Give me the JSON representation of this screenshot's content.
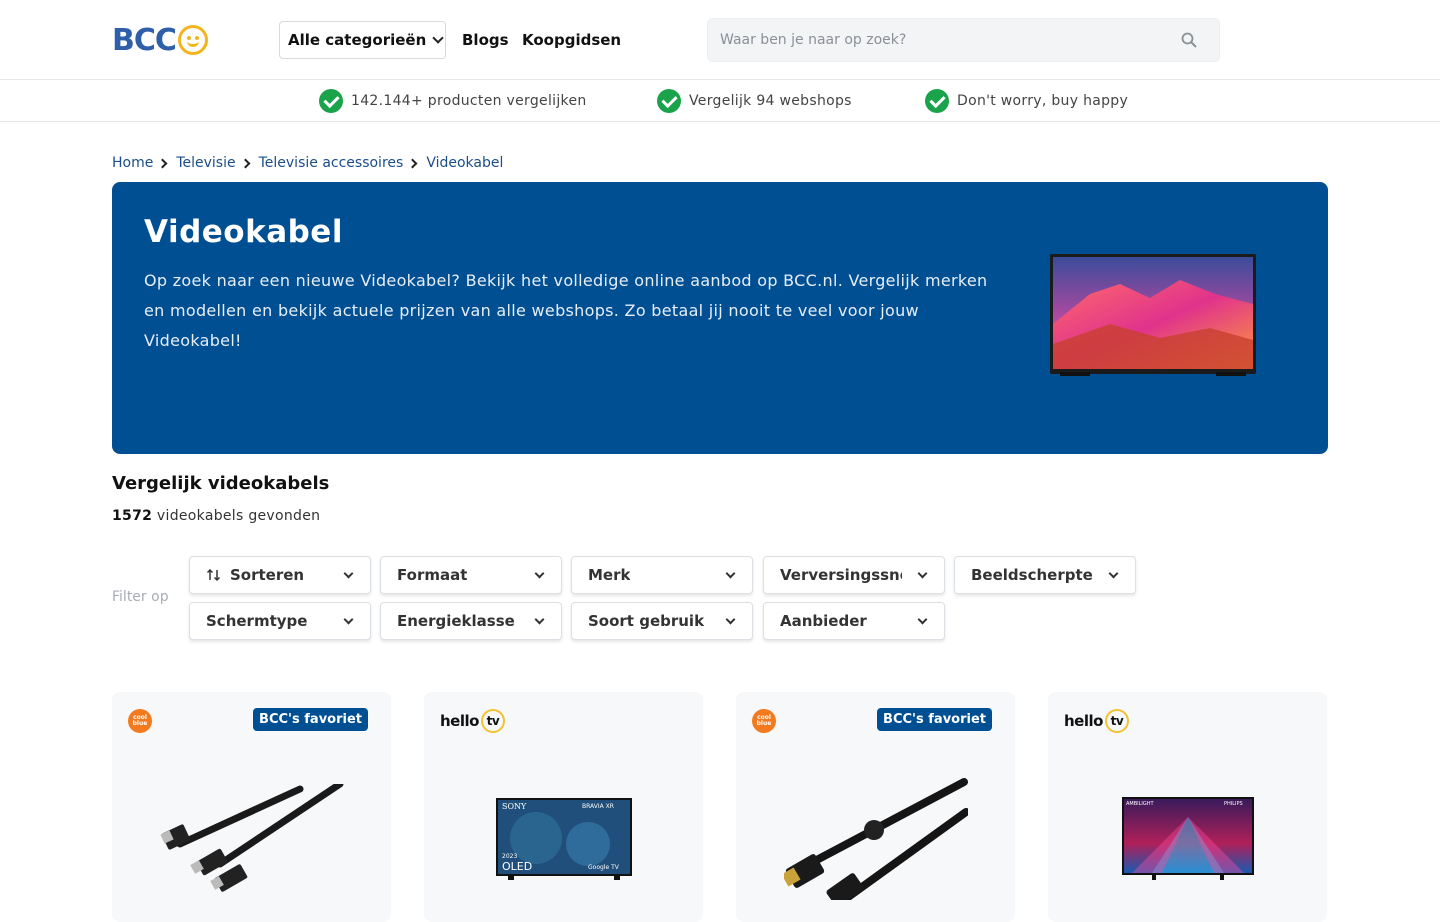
{
  "header": {
    "logo_text": "BCC",
    "category_button": "Alle categorieën",
    "nav": [
      "Blogs",
      "Koopgidsen"
    ],
    "search_placeholder": "Waar ben je naar op zoek?"
  },
  "usps": [
    "142.144+ producten vergelijken",
    "Vergelijk 94 webshops",
    "Don't worry, buy happy"
  ],
  "breadcrumb": [
    "Home",
    "Televisie",
    "Televisie accessoires",
    "Videokabel"
  ],
  "hero": {
    "title": "Videokabel",
    "description": "Op zoek naar een nieuwe Videokabel? Bekijk het volledige online aanbod op BCC.nl. Vergelijk merken en modellen en bekijk actuele prijzen van alle webshops. Zo betaal jij nooit te veel voor jouw Videokabel!"
  },
  "section": {
    "title": "Vergelijk videokabels",
    "count": "1572",
    "count_suffix": " videokabels gevonden",
    "filter_label": "Filter op"
  },
  "filters": [
    "Sorteren",
    "Formaat",
    "Merk",
    "Verversingssnelheid",
    "Beeldscherpte",
    "Schermtype",
    "Energieklasse",
    "Soort gebruik",
    "Aanbieder"
  ],
  "cards": [
    {
      "shop": "coolblue",
      "shop_text": "cool blue",
      "badge": "BCC's favoriet",
      "image": "hdmi-cable"
    },
    {
      "shop": "hellotv",
      "shop_text": "hello",
      "shop_tv": "tv",
      "badge": "",
      "image": "sony-oled-tv"
    },
    {
      "shop": "coolblue",
      "shop_text": "cool blue",
      "badge": "BCC's favoriet",
      "image": "displayport-cable"
    },
    {
      "shop": "hellotv",
      "shop_text": "hello",
      "shop_tv": "tv",
      "badge": "",
      "image": "philips-ambilight-tv"
    }
  ],
  "tv_labels": {
    "sony": "SONY",
    "bravia": "BRAVIA XR",
    "oled": "OLED",
    "year": "2023",
    "google": "Google TV",
    "philips": "PHILIPS",
    "ambilight": "AMBILIGHT"
  },
  "colors": {
    "primary": "#004f93",
    "check_green": "#1aa34a",
    "logo_blue": "#2f5fa8",
    "logo_yellow": "#f2b51d",
    "coolblue_orange": "#f47a20"
  }
}
